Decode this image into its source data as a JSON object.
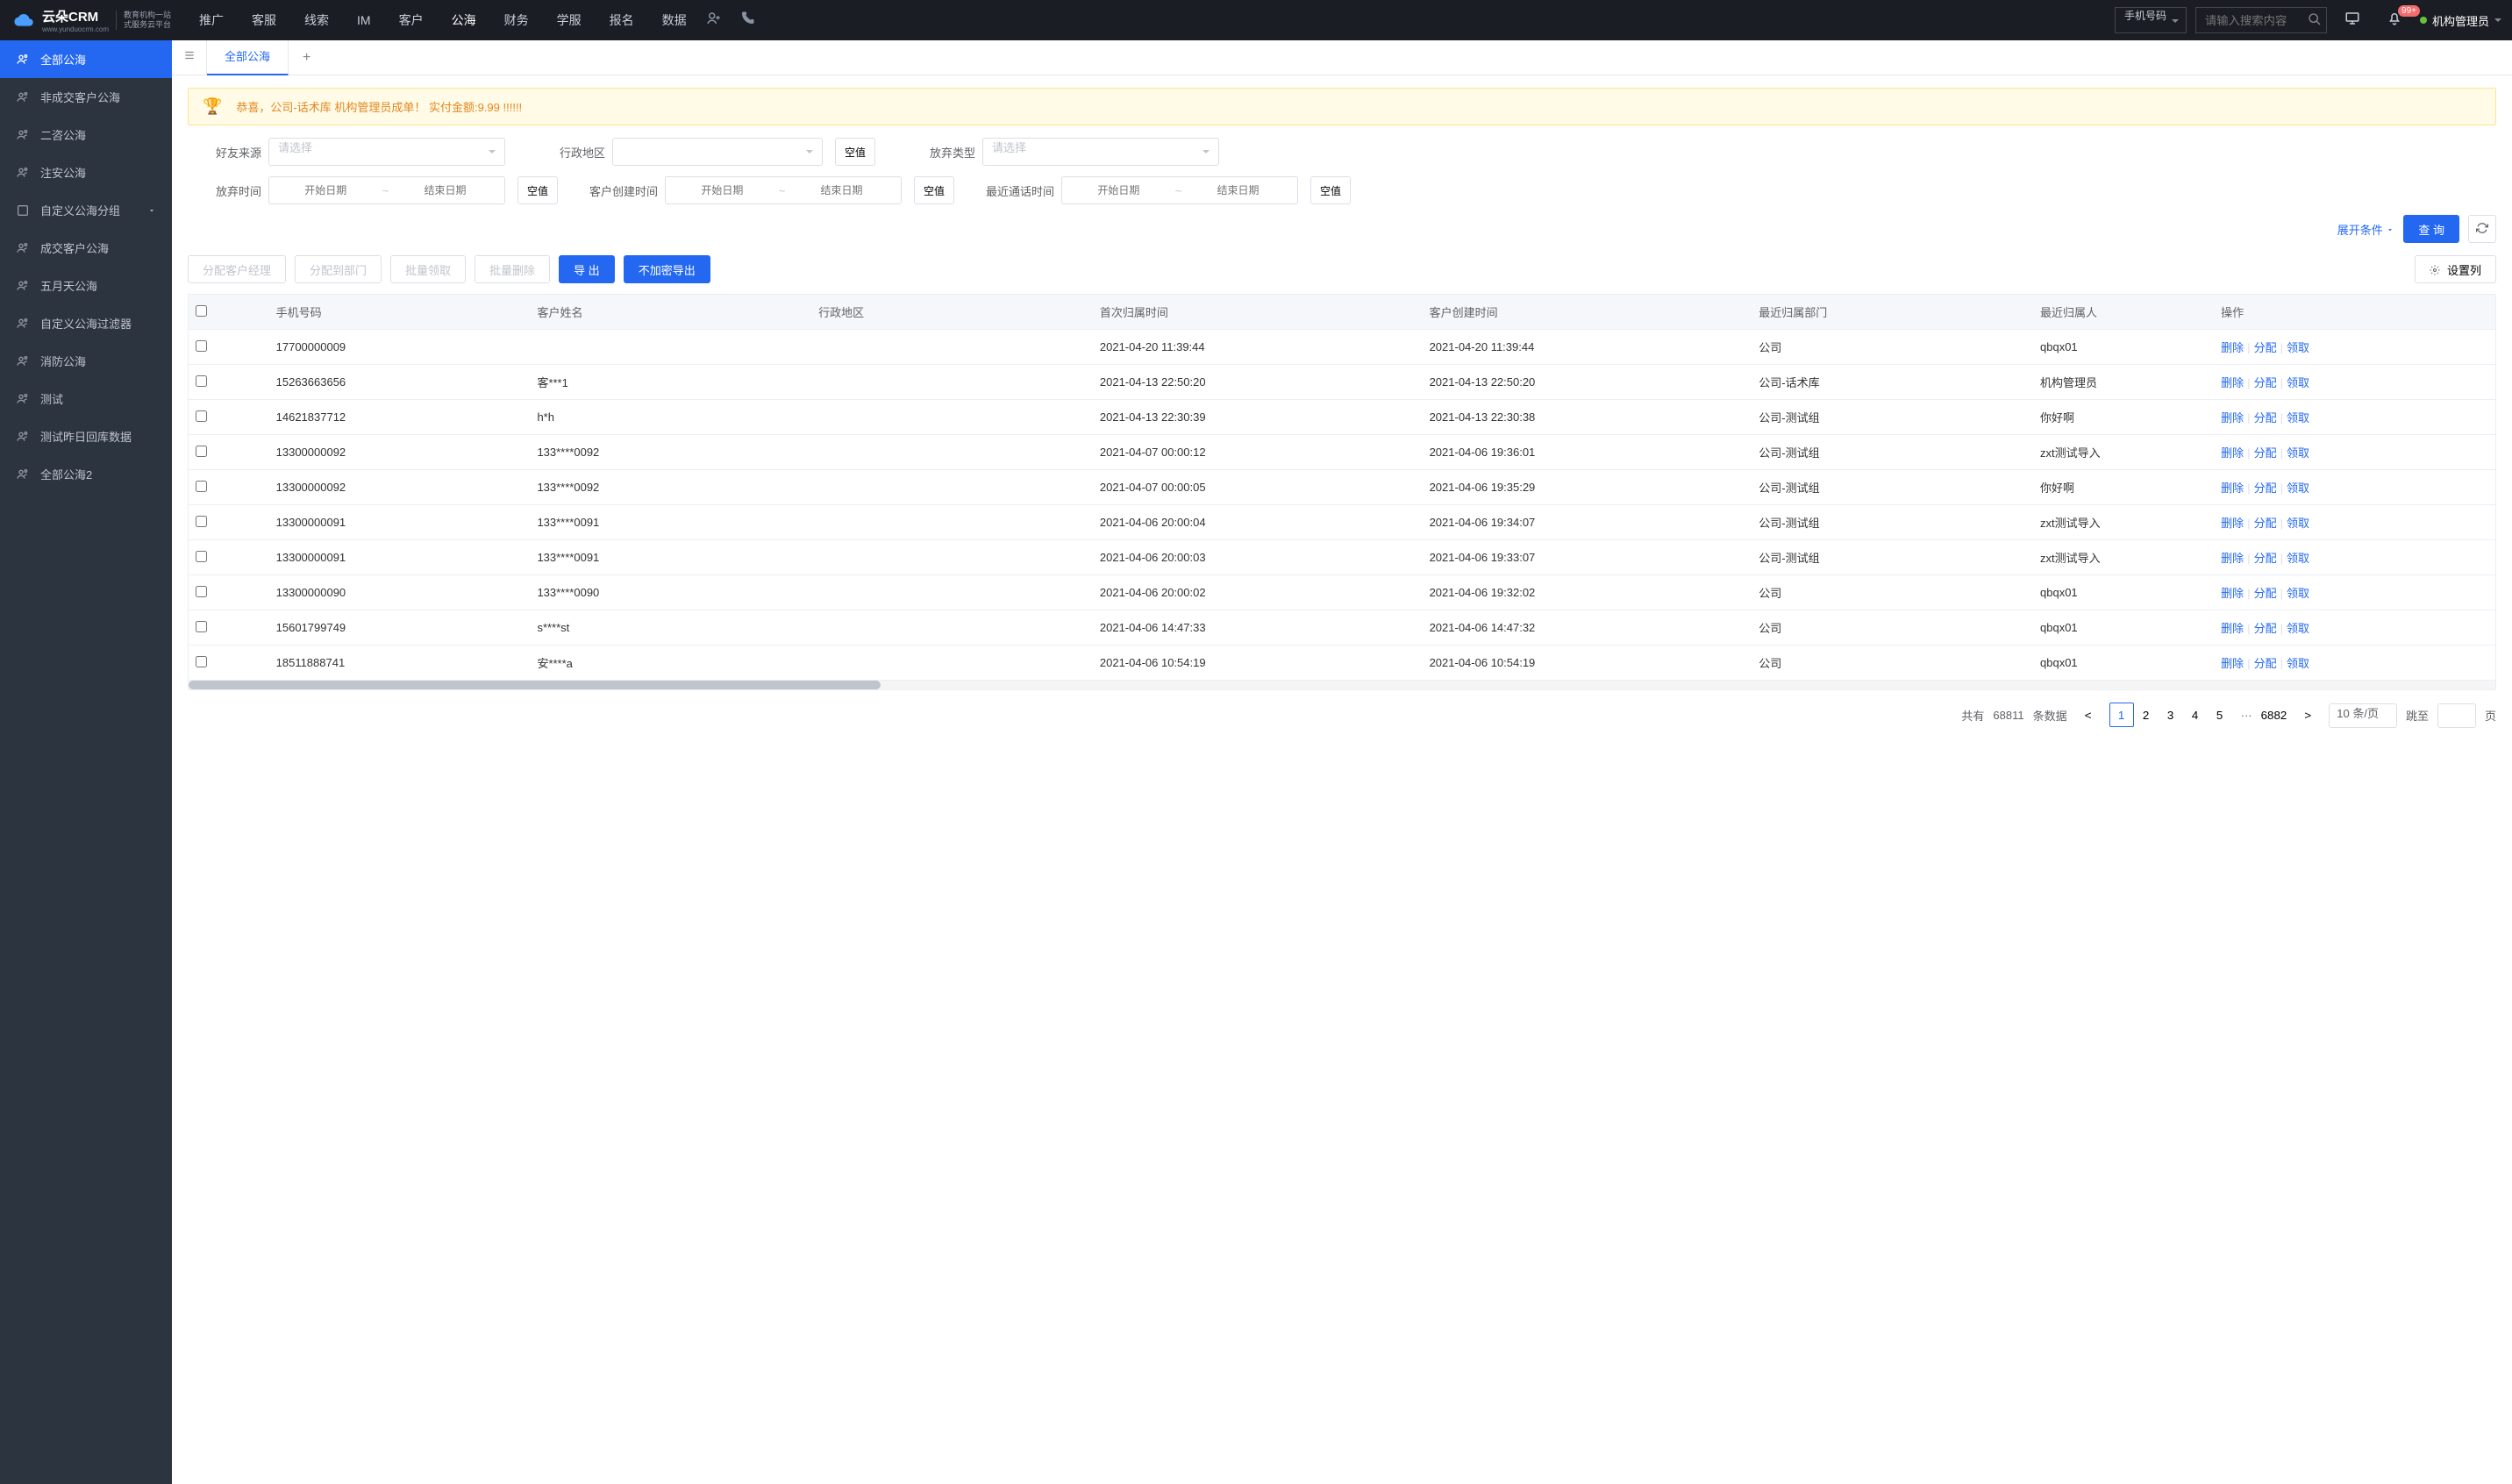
{
  "header": {
    "logo": "云朵CRM",
    "logo_url": "www.yunduocrm.com",
    "logo_sub1": "教育机构一站",
    "logo_sub2": "式服务云平台",
    "nav": [
      "推广",
      "客服",
      "线索",
      "IM",
      "客户",
      "公海",
      "财务",
      "学服",
      "报名",
      "数据"
    ],
    "nav_active_index": 5,
    "search_type": "手机号码",
    "search_placeholder": "请输入搜索内容",
    "badge": "99+",
    "user": "机构管理员"
  },
  "sidebar": [
    {
      "label": "全部公海",
      "active": true
    },
    {
      "label": "非成交客户公海"
    },
    {
      "label": "二咨公海"
    },
    {
      "label": "注安公海"
    },
    {
      "label": "自定义公海分组",
      "expandable": true
    },
    {
      "label": "成交客户公海"
    },
    {
      "label": "五月天公海"
    },
    {
      "label": "自定义公海过滤器"
    },
    {
      "label": "消防公海"
    },
    {
      "label": "测试"
    },
    {
      "label": "测试昨日回库数据"
    },
    {
      "label": "全部公海2"
    }
  ],
  "tab": {
    "active": "全部公海"
  },
  "banner": "恭喜，公司-话术库  机构管理员成单！  实付金额:9.99 !!!!!!",
  "filters": {
    "source": {
      "label": "好友来源",
      "placeholder": "请选择"
    },
    "region": {
      "label": "行政地区"
    },
    "abandon_type": {
      "label": "放弃类型",
      "placeholder": "请选择"
    },
    "abandon_time": {
      "label": "放弃时间"
    },
    "create_time": {
      "label": "客户创建时间"
    },
    "last_call": {
      "label": "最近通话时间"
    },
    "date_start": "开始日期",
    "date_end": "结束日期",
    "empty": "空值",
    "expand": "展开条件",
    "query": "查 询"
  },
  "toolbar": {
    "assign_mgr": "分配客户经理",
    "assign_dept": "分配到部门",
    "batch_claim": "批量领取",
    "batch_delete": "批量删除",
    "export": "导 出",
    "export_plain": "不加密导出",
    "set_cols": "设置列"
  },
  "table": {
    "columns": [
      "手机号码",
      "客户姓名",
      "行政地区",
      "首次归属时间",
      "客户创建时间",
      "最近归属部门",
      "最近归属人",
      "操作"
    ],
    "actions": {
      "delete": "删除",
      "assign": "分配",
      "claim": "领取"
    },
    "rows": [
      {
        "phone": "17700000009",
        "name": "",
        "region": "",
        "first_time": "2021-04-20 11:39:44",
        "create_time": "2021-04-20 11:39:44",
        "dept": "公司",
        "person": "qbqx01"
      },
      {
        "phone": "15263663656",
        "name": "客***1",
        "region": "",
        "first_time": "2021-04-13 22:50:20",
        "create_time": "2021-04-13 22:50:20",
        "dept": "公司-话术库",
        "person": "机构管理员"
      },
      {
        "phone": "14621837712",
        "name": "h*h",
        "region": "",
        "first_time": "2021-04-13 22:30:39",
        "create_time": "2021-04-13 22:30:38",
        "dept": "公司-测试组",
        "person": "你好啊"
      },
      {
        "phone": "13300000092",
        "name": "133****0092",
        "region": "",
        "first_time": "2021-04-07 00:00:12",
        "create_time": "2021-04-06 19:36:01",
        "dept": "公司-测试组",
        "person": "zxt测试导入"
      },
      {
        "phone": "13300000092",
        "name": "133****0092",
        "region": "",
        "first_time": "2021-04-07 00:00:05",
        "create_time": "2021-04-06 19:35:29",
        "dept": "公司-测试组",
        "person": "你好啊"
      },
      {
        "phone": "13300000091",
        "name": "133****0091",
        "region": "",
        "first_time": "2021-04-06 20:00:04",
        "create_time": "2021-04-06 19:34:07",
        "dept": "公司-测试组",
        "person": "zxt测试导入"
      },
      {
        "phone": "13300000091",
        "name": "133****0091",
        "region": "",
        "first_time": "2021-04-06 20:00:03",
        "create_time": "2021-04-06 19:33:07",
        "dept": "公司-测试组",
        "person": "zxt测试导入"
      },
      {
        "phone": "13300000090",
        "name": "133****0090",
        "region": "",
        "first_time": "2021-04-06 20:00:02",
        "create_time": "2021-04-06 19:32:02",
        "dept": "公司",
        "person": "qbqx01"
      },
      {
        "phone": "15601799749",
        "name": "s****st",
        "region": "",
        "first_time": "2021-04-06 14:47:33",
        "create_time": "2021-04-06 14:47:32",
        "dept": "公司",
        "person": "qbqx01"
      },
      {
        "phone": "18511888741",
        "name": "安****a",
        "region": "",
        "first_time": "2021-04-06 10:54:19",
        "create_time": "2021-04-06 10:54:19",
        "dept": "公司",
        "person": "qbqx01"
      }
    ]
  },
  "pagination": {
    "prefix": "共有",
    "total": "68811",
    "suffix": "条数据",
    "pages": [
      "1",
      "2",
      "3",
      "4",
      "5"
    ],
    "last": "6882",
    "per_page": "10 条/页",
    "goto": "跳至",
    "page_unit": "页"
  }
}
